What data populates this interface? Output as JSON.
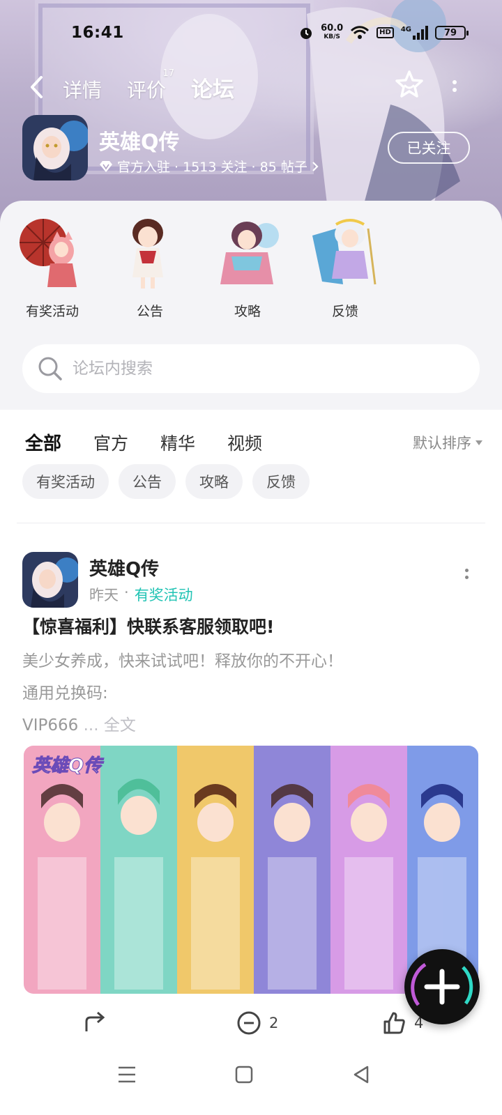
{
  "status_bar": {
    "time": "16:41",
    "net_speed_value": "60.0",
    "net_speed_unit": "KB/S",
    "network_type": "4G",
    "hd_label": "HD",
    "battery": "79"
  },
  "nav": {
    "tabs": [
      {
        "label": "详情"
      },
      {
        "label": "评价",
        "badge": "17"
      },
      {
        "label": "论坛"
      }
    ],
    "active_tab": "论坛"
  },
  "game": {
    "name": "英雄Q传",
    "meta": "官方入驻 · 1513 关注 · 85 帖子",
    "follow_label": "已关注"
  },
  "categories": [
    {
      "label": "有奖活动"
    },
    {
      "label": "公告"
    },
    {
      "label": "攻略"
    },
    {
      "label": "反馈"
    }
  ],
  "search": {
    "placeholder": "论坛内搜索"
  },
  "filters": {
    "tabs": [
      {
        "label": "全部"
      },
      {
        "label": "官方"
      },
      {
        "label": "精华"
      },
      {
        "label": "视频"
      }
    ],
    "sort_label": "默认排序",
    "chips": [
      {
        "label": "有奖活动"
      },
      {
        "label": "公告"
      },
      {
        "label": "攻略"
      },
      {
        "label": "反馈"
      }
    ]
  },
  "post": {
    "author": "英雄Q传",
    "time": "昨天",
    "tag": "有奖活动",
    "title": "【惊喜福利】快联系客服领取吧!",
    "body_line1": "美少女养成，快来试试吧！释放你的不开心！",
    "body_line2": "通用兑换码:",
    "body_line3": "VIP666",
    "ellipsis": "...",
    "full_text_label": "全文",
    "image_logo_text": "英雄Q传",
    "comment_count": "2",
    "like_count": "4"
  },
  "colors": {
    "accent": "#2fd9c6",
    "tag": "#21c3b4",
    "hero_bg": "#b9aecb",
    "panel_bg": "#f4f4f7"
  }
}
